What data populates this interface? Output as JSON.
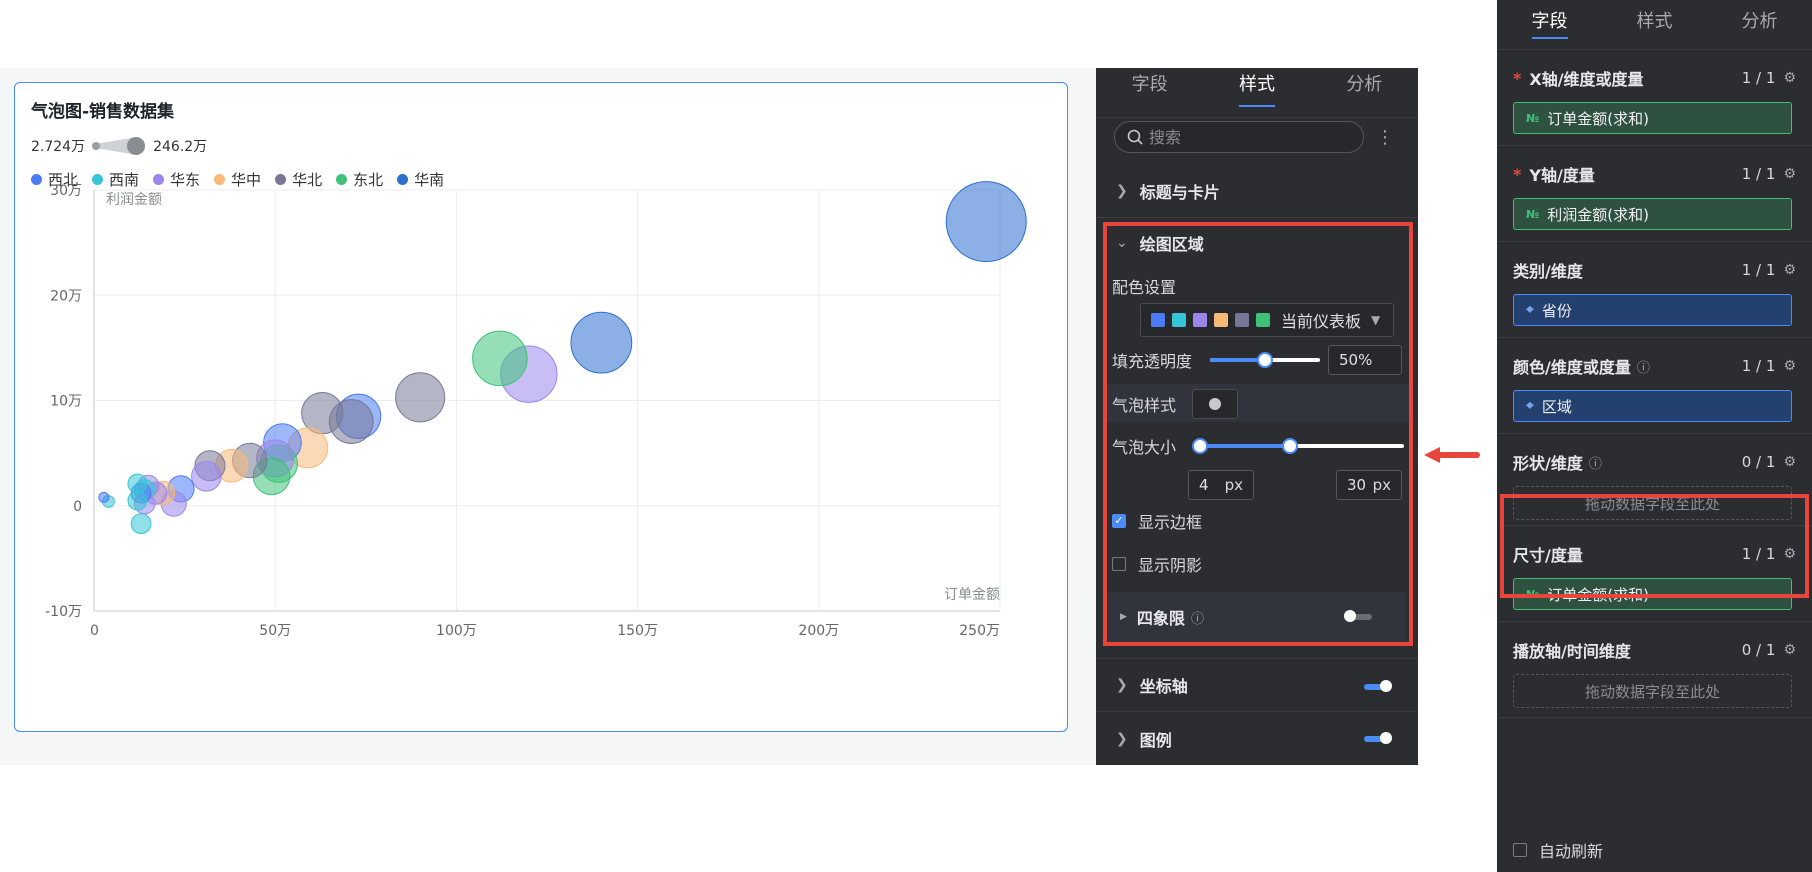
{
  "chart": {
    "title": "气泡图-销售数据集",
    "size_legend": {
      "min": "2.724万",
      "max": "246.2万"
    },
    "legend": [
      {
        "name": "西北",
        "color": "#4b7bf5"
      },
      {
        "name": "西南",
        "color": "#36c5d6"
      },
      {
        "name": "华东",
        "color": "#9b86ec"
      },
      {
        "name": "华中",
        "color": "#f7b97a"
      },
      {
        "name": "华北",
        "color": "#767896"
      },
      {
        "name": "东北",
        "color": "#3ec27a"
      },
      {
        "name": "华南",
        "color": "#2d6fcf"
      }
    ],
    "y_title": "利润金额",
    "x_title": "订单金额"
  },
  "chart_data": {
    "type": "scatter",
    "title": "气泡图-销售数据集",
    "xlabel": "订单金额",
    "ylabel": "利润金额",
    "xlim": [
      0,
      2500000
    ],
    "ylim": [
      -100000,
      300000
    ],
    "x_ticks": [
      "0",
      "50万",
      "100万",
      "150万",
      "200万",
      "250万"
    ],
    "y_ticks": [
      "-10万",
      "0",
      "10万",
      "20万",
      "30万"
    ],
    "grid": true,
    "legend_position": "top-left",
    "points": [
      {
        "x": 2462000,
        "y": 270000,
        "size": 2462000,
        "series": "华南"
      },
      {
        "x": 1400000,
        "y": 155000,
        "size": 1400000,
        "series": "华南"
      },
      {
        "x": 1120000,
        "y": 140000,
        "size": 1120000,
        "series": "东北"
      },
      {
        "x": 1200000,
        "y": 125000,
        "size": 1200000,
        "series": "华东"
      },
      {
        "x": 900000,
        "y": 103000,
        "size": 900000,
        "series": "华北"
      },
      {
        "x": 630000,
        "y": 88000,
        "size": 630000,
        "series": "华北"
      },
      {
        "x": 710000,
        "y": 80000,
        "size": 710000,
        "series": "华北"
      },
      {
        "x": 730000,
        "y": 85000,
        "size": 730000,
        "series": "西北"
      },
      {
        "x": 520000,
        "y": 60000,
        "size": 520000,
        "series": "西北"
      },
      {
        "x": 590000,
        "y": 55000,
        "size": 590000,
        "series": "华中"
      },
      {
        "x": 500000,
        "y": 45000,
        "size": 500000,
        "series": "华东"
      },
      {
        "x": 510000,
        "y": 40000,
        "size": 510000,
        "series": "东北"
      },
      {
        "x": 490000,
        "y": 28000,
        "size": 490000,
        "series": "东北"
      },
      {
        "x": 430000,
        "y": 43000,
        "size": 430000,
        "series": "华北"
      },
      {
        "x": 380000,
        "y": 38000,
        "size": 380000,
        "series": "华中"
      },
      {
        "x": 320000,
        "y": 38000,
        "size": 320000,
        "series": "华北"
      },
      {
        "x": 310000,
        "y": 28000,
        "size": 310000,
        "series": "华东"
      },
      {
        "x": 240000,
        "y": 16000,
        "size": 240000,
        "series": "西北"
      },
      {
        "x": 220000,
        "y": 2000,
        "size": 220000,
        "series": "华东"
      },
      {
        "x": 190000,
        "y": 12000,
        "size": 190000,
        "series": "华中"
      },
      {
        "x": 170000,
        "y": 12000,
        "size": 170000,
        "series": "华东"
      },
      {
        "x": 150000,
        "y": 19000,
        "size": 150000,
        "series": "华东"
      },
      {
        "x": 140000,
        "y": 15000,
        "size": 140000,
        "series": "西南"
      },
      {
        "x": 130000,
        "y": 12000,
        "size": 130000,
        "series": "西北"
      },
      {
        "x": 140000,
        "y": 2000,
        "size": 140000,
        "series": "华东"
      },
      {
        "x": 120000,
        "y": 5000,
        "size": 120000,
        "series": "西南"
      },
      {
        "x": 120000,
        "y": 21000,
        "size": 120000,
        "series": "西南"
      },
      {
        "x": 130000,
        "y": -17000,
        "size": 130000,
        "series": "西南"
      },
      {
        "x": 40000,
        "y": 4000,
        "size": 40000,
        "series": "西南"
      },
      {
        "x": 27240,
        "y": 8000,
        "size": 27240,
        "series": "西北"
      }
    ]
  },
  "style_panel": {
    "tabs": [
      "字段",
      "样式",
      "分析"
    ],
    "active_tab": "样式",
    "search_placeholder": "搜索",
    "sections": {
      "title_card": "标题与卡片",
      "plot_area": "绘图区域",
      "quadrant": "四象限",
      "axis": "坐标轴",
      "legend": "图例"
    },
    "color_setting_label": "配色设置",
    "palette_name": "当前仪表板",
    "palette": [
      "#4b7bf5",
      "#36c5d6",
      "#9b86ec",
      "#f7b97a",
      "#767896",
      "#3ec27a"
    ],
    "fill_opacity_label": "填充透明度",
    "fill_opacity_value": "50%",
    "fill_opacity": 0.5,
    "bubble_style_label": "气泡样式",
    "bubble_size_label": "气泡大小",
    "bubble_size_min": "4",
    "bubble_size_max": "30",
    "unit": "px",
    "show_border_label": "显示边框",
    "show_border": true,
    "show_shadow_label": "显示阴影",
    "show_shadow": false
  },
  "field_panel": {
    "tabs": [
      "字段",
      "样式",
      "分析"
    ],
    "active_tab": "字段",
    "sections": [
      {
        "label": "X轴/维度或度量",
        "required": true,
        "count": "1 / 1",
        "field": "订单金额(求和)",
        "kind": "measure"
      },
      {
        "label": "Y轴/度量",
        "required": true,
        "count": "1 / 1",
        "field": "利润金额(求和)",
        "kind": "measure"
      },
      {
        "label": "类别/维度",
        "required": false,
        "count": "1 / 1",
        "field": "省份",
        "kind": "dim"
      },
      {
        "label": "颜色/维度或度量",
        "required": false,
        "count": "1 / 1",
        "field": "区域",
        "kind": "dim"
      },
      {
        "label": "形状/维度",
        "required": false,
        "count": "0 / 1",
        "field": "",
        "kind": "empty"
      },
      {
        "label": "尺寸/度量",
        "required": false,
        "count": "1 / 1",
        "field": "订单金额(求和)",
        "kind": "measure"
      },
      {
        "label": "播放轴/时间维度",
        "required": false,
        "count": "0 / 1",
        "field": "",
        "kind": "empty"
      }
    ],
    "drop_placeholder": "拖动数据字段至此处",
    "auto_refresh_label": "自动刷新",
    "measure_icon": "№"
  }
}
